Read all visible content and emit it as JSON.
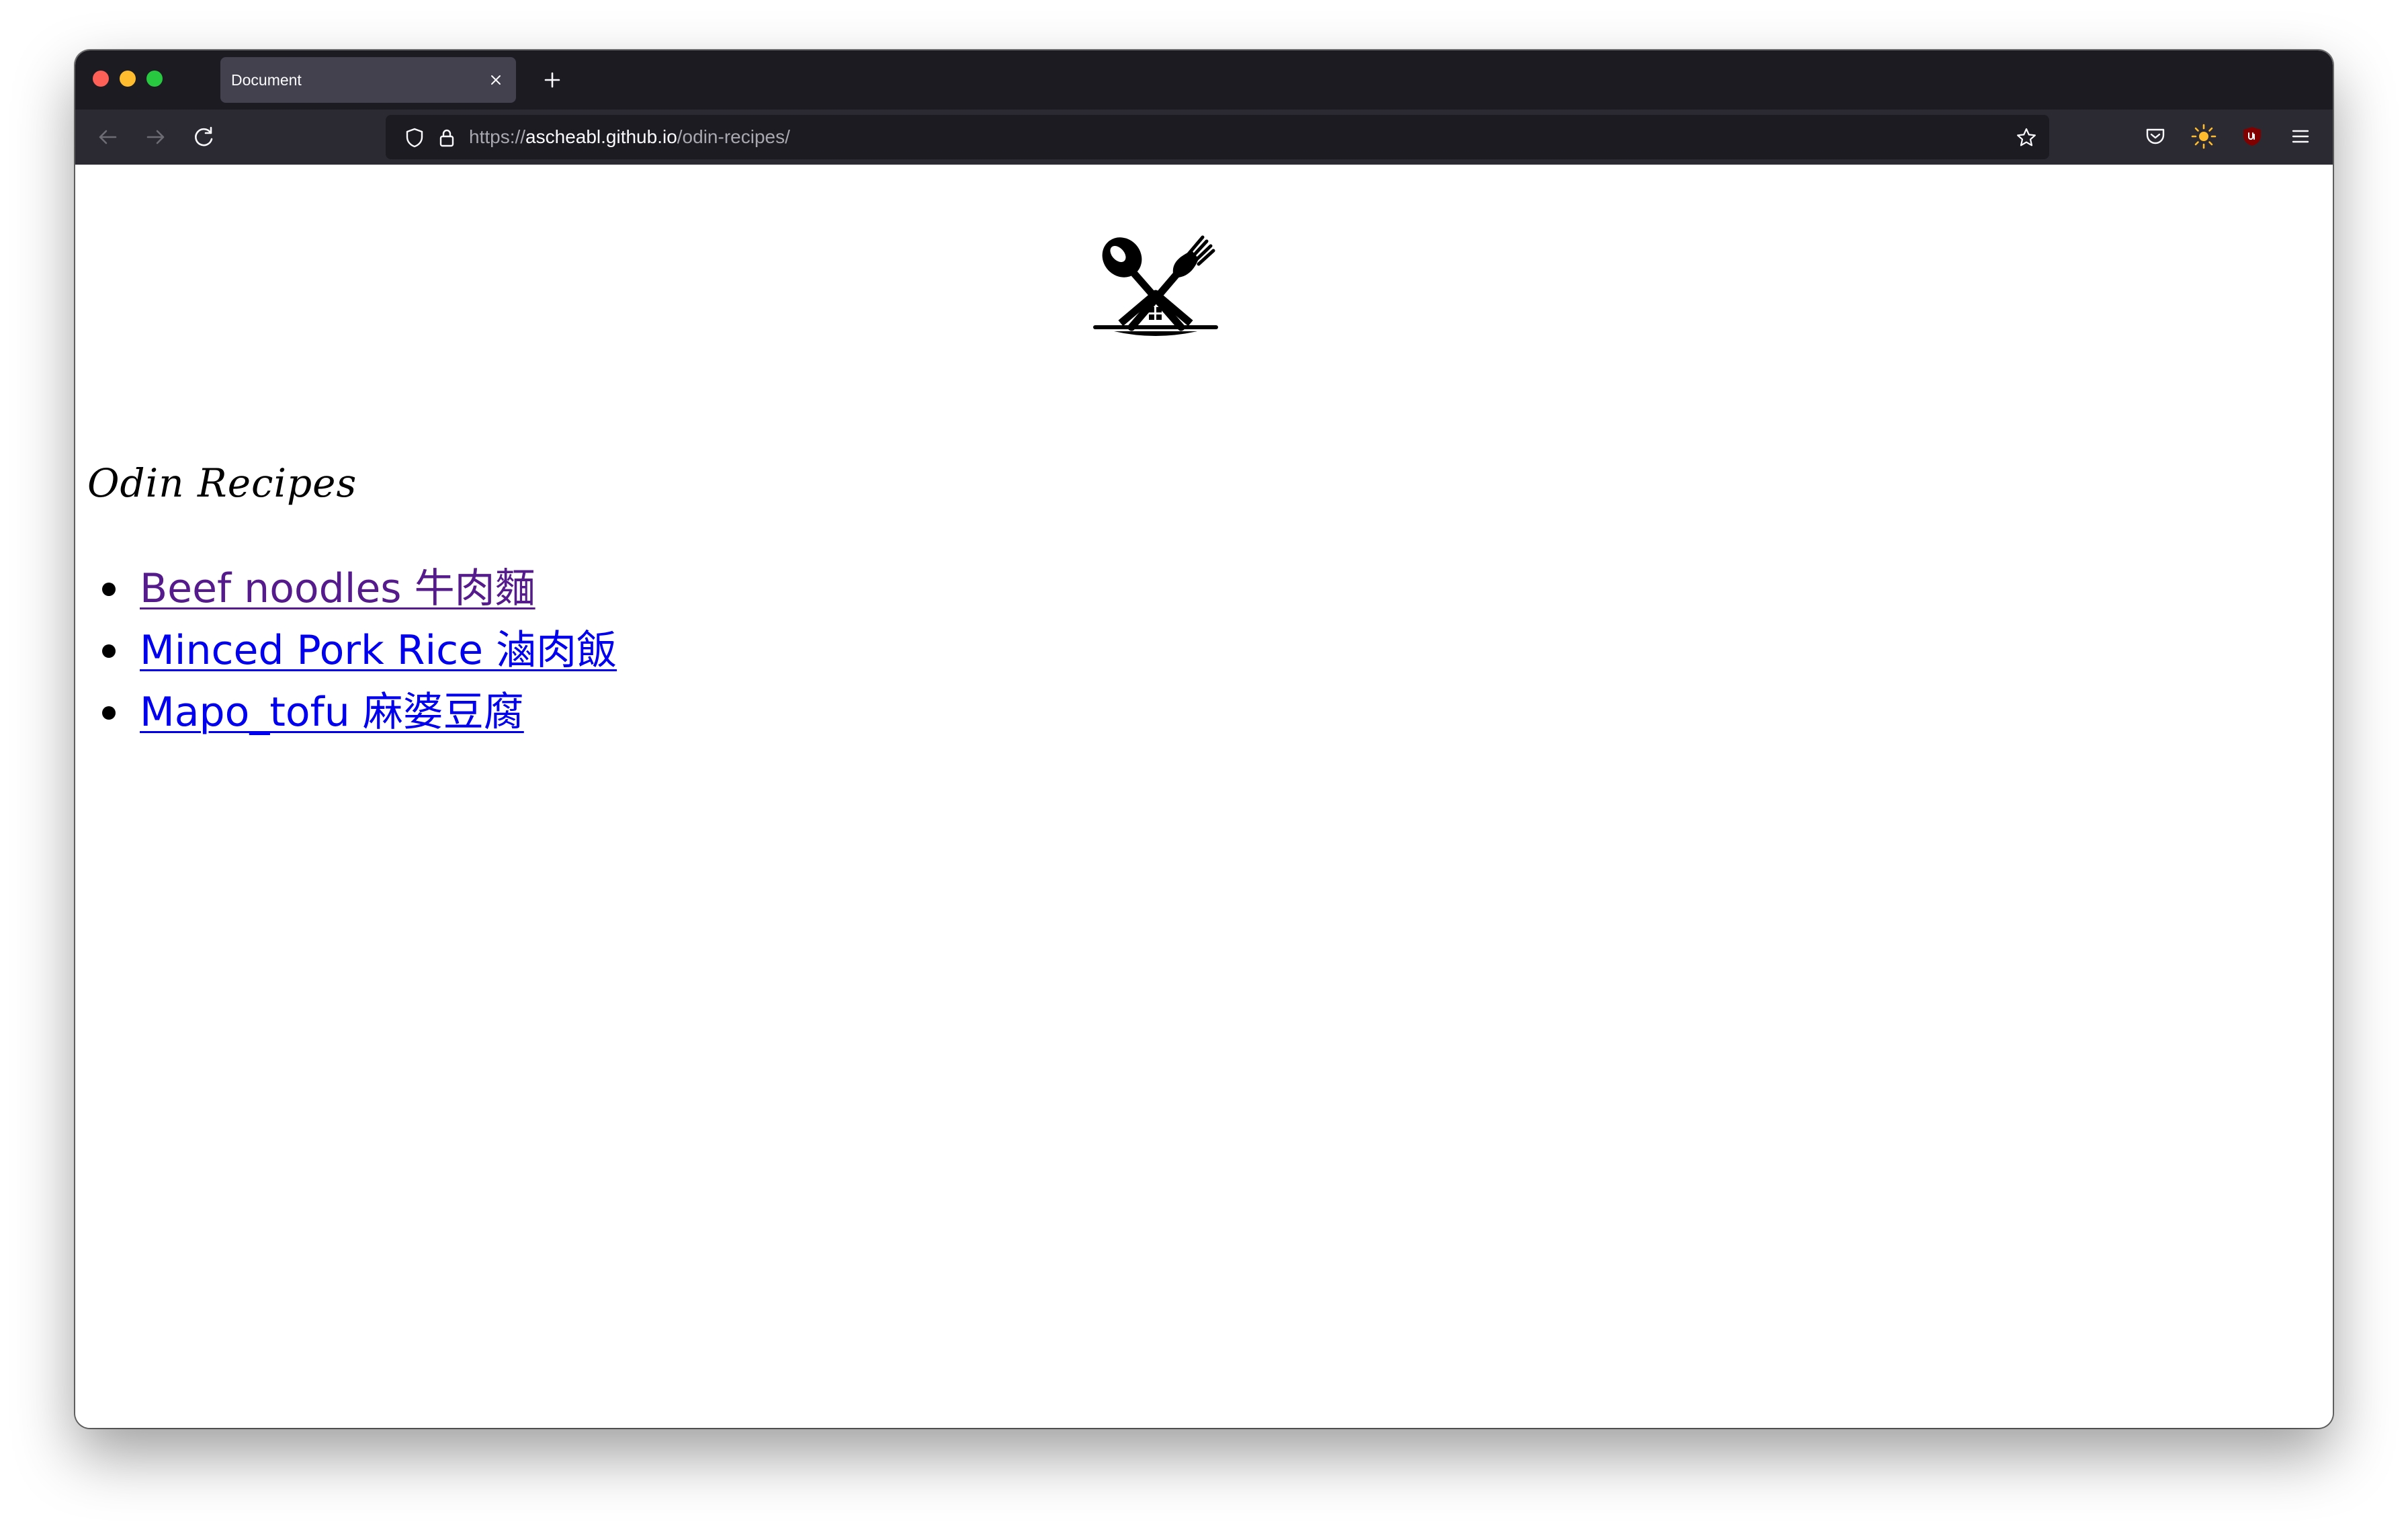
{
  "browser": {
    "tab": {
      "title": "Document"
    },
    "address": {
      "scheme": "https://",
      "host": "ascheabl.github.io",
      "path": "/odin-recipes/"
    },
    "colors": {
      "tabstrip_bg": "#1c1b22",
      "navbar_bg": "#2b2a33",
      "active_tab_bg": "#42414d",
      "sun_icon": "#ffbd2e",
      "ublock_icon": "#800000"
    }
  },
  "page": {
    "logo_icon": "spoon-fork-house-logo",
    "title": "Odin Recipes",
    "recipes": [
      {
        "label": "Beef noodles 牛肉麵",
        "state": "visited"
      },
      {
        "label": "Minced Pork Rice 滷肉飯",
        "state": "unvisited"
      },
      {
        "label": "Mapo_tofu 麻婆豆腐",
        "state": "unvisited"
      }
    ],
    "colors": {
      "link": "#0000ee",
      "visited_link": "#551a8b"
    }
  }
}
